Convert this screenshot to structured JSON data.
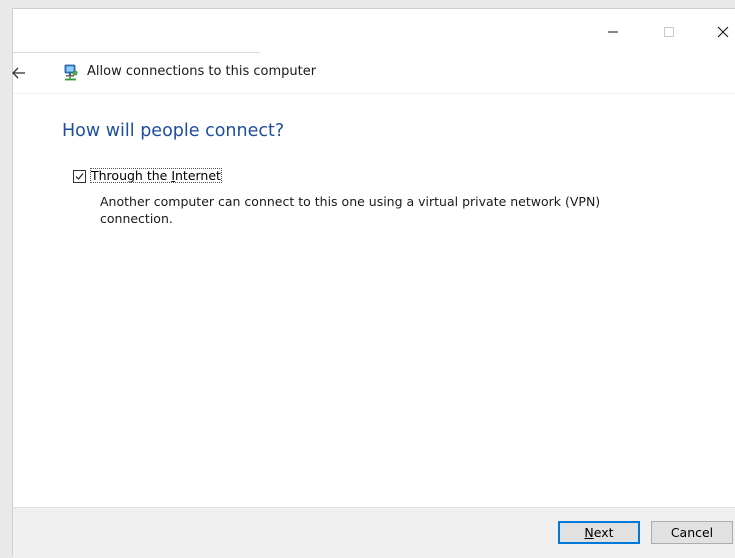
{
  "window": {
    "controls": {
      "minimize_icon": "minimize-icon",
      "maximize_icon": "maximize-icon",
      "close_icon": "close-icon"
    }
  },
  "nav": {
    "back_icon": "back-arrow-icon",
    "app_icon": "network-icon",
    "title": "Allow connections to this computer"
  },
  "main": {
    "heading": "How will people connect?",
    "option": {
      "checked": true,
      "label_pre": "Through the ",
      "label_access_key": "I",
      "label_post": "nternet",
      "description": "Another computer can connect to this one using a virtual private network (VPN) connection."
    }
  },
  "footer": {
    "next": {
      "access_key": "N",
      "rest": "ext"
    },
    "cancel_label": "Cancel"
  },
  "colors": {
    "heading": "#1e4e9c",
    "default_button_border": "#0078d7",
    "footer_bg": "#f0f0f0"
  }
}
